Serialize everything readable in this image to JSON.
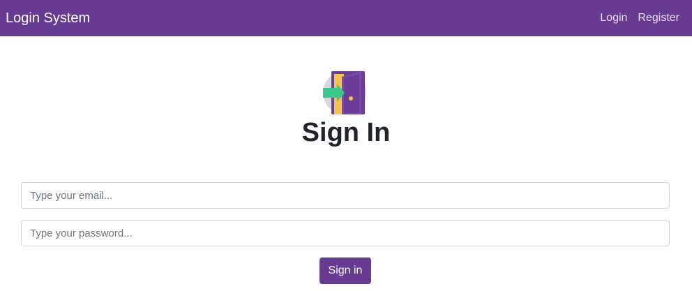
{
  "navbar": {
    "brand": "Login System",
    "links": [
      {
        "label": "Login"
      },
      {
        "label": "Register"
      }
    ],
    "background": "#663b91"
  },
  "form": {
    "icon": "door-enter-icon",
    "title": "Sign In",
    "email_placeholder": "Type your email...",
    "password_placeholder": "Type your password...",
    "submit_label": "Sign in",
    "accent": "#663b91"
  }
}
